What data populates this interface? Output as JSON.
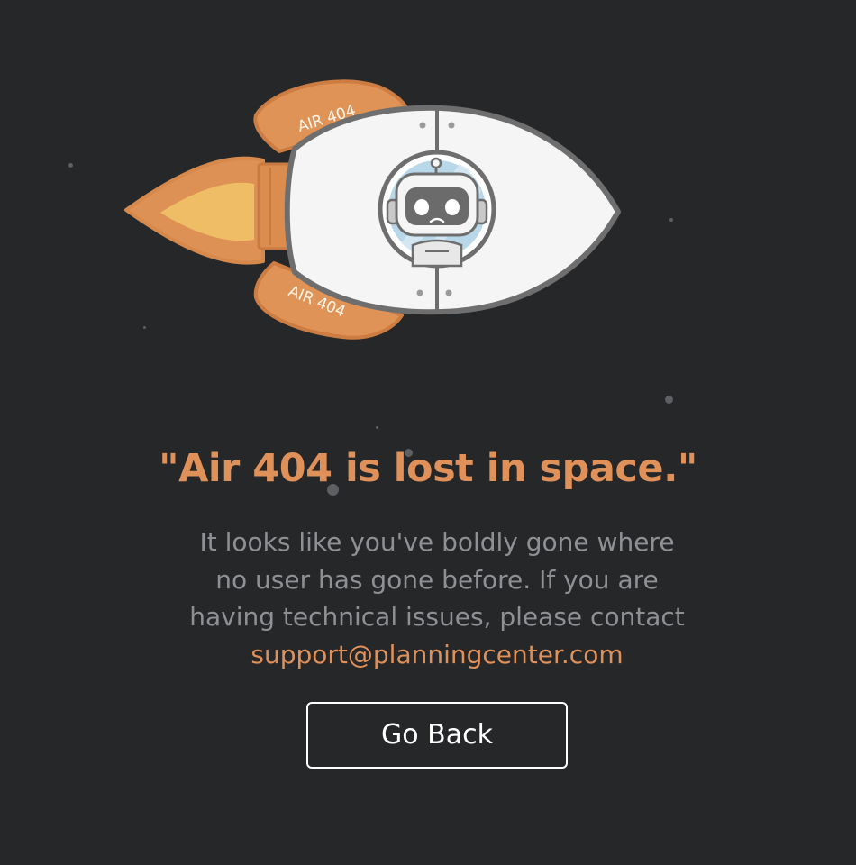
{
  "colors": {
    "background": "#262729",
    "accent": "#e0915a",
    "body_text": "#8f9094",
    "button_border": "#ffffff"
  },
  "illustration": {
    "fin_top_label": "AIR 404",
    "fin_bottom_label": "AIR 404"
  },
  "headline": "\"Air 404 is lost in space.\"",
  "message": {
    "line1": "It looks like you've boldly gone where",
    "line2": "no user has gone before. If you are",
    "line3": "having technical issues, please contact",
    "support_email": "support@planningcenter.com"
  },
  "button": {
    "label": "Go Back"
  }
}
